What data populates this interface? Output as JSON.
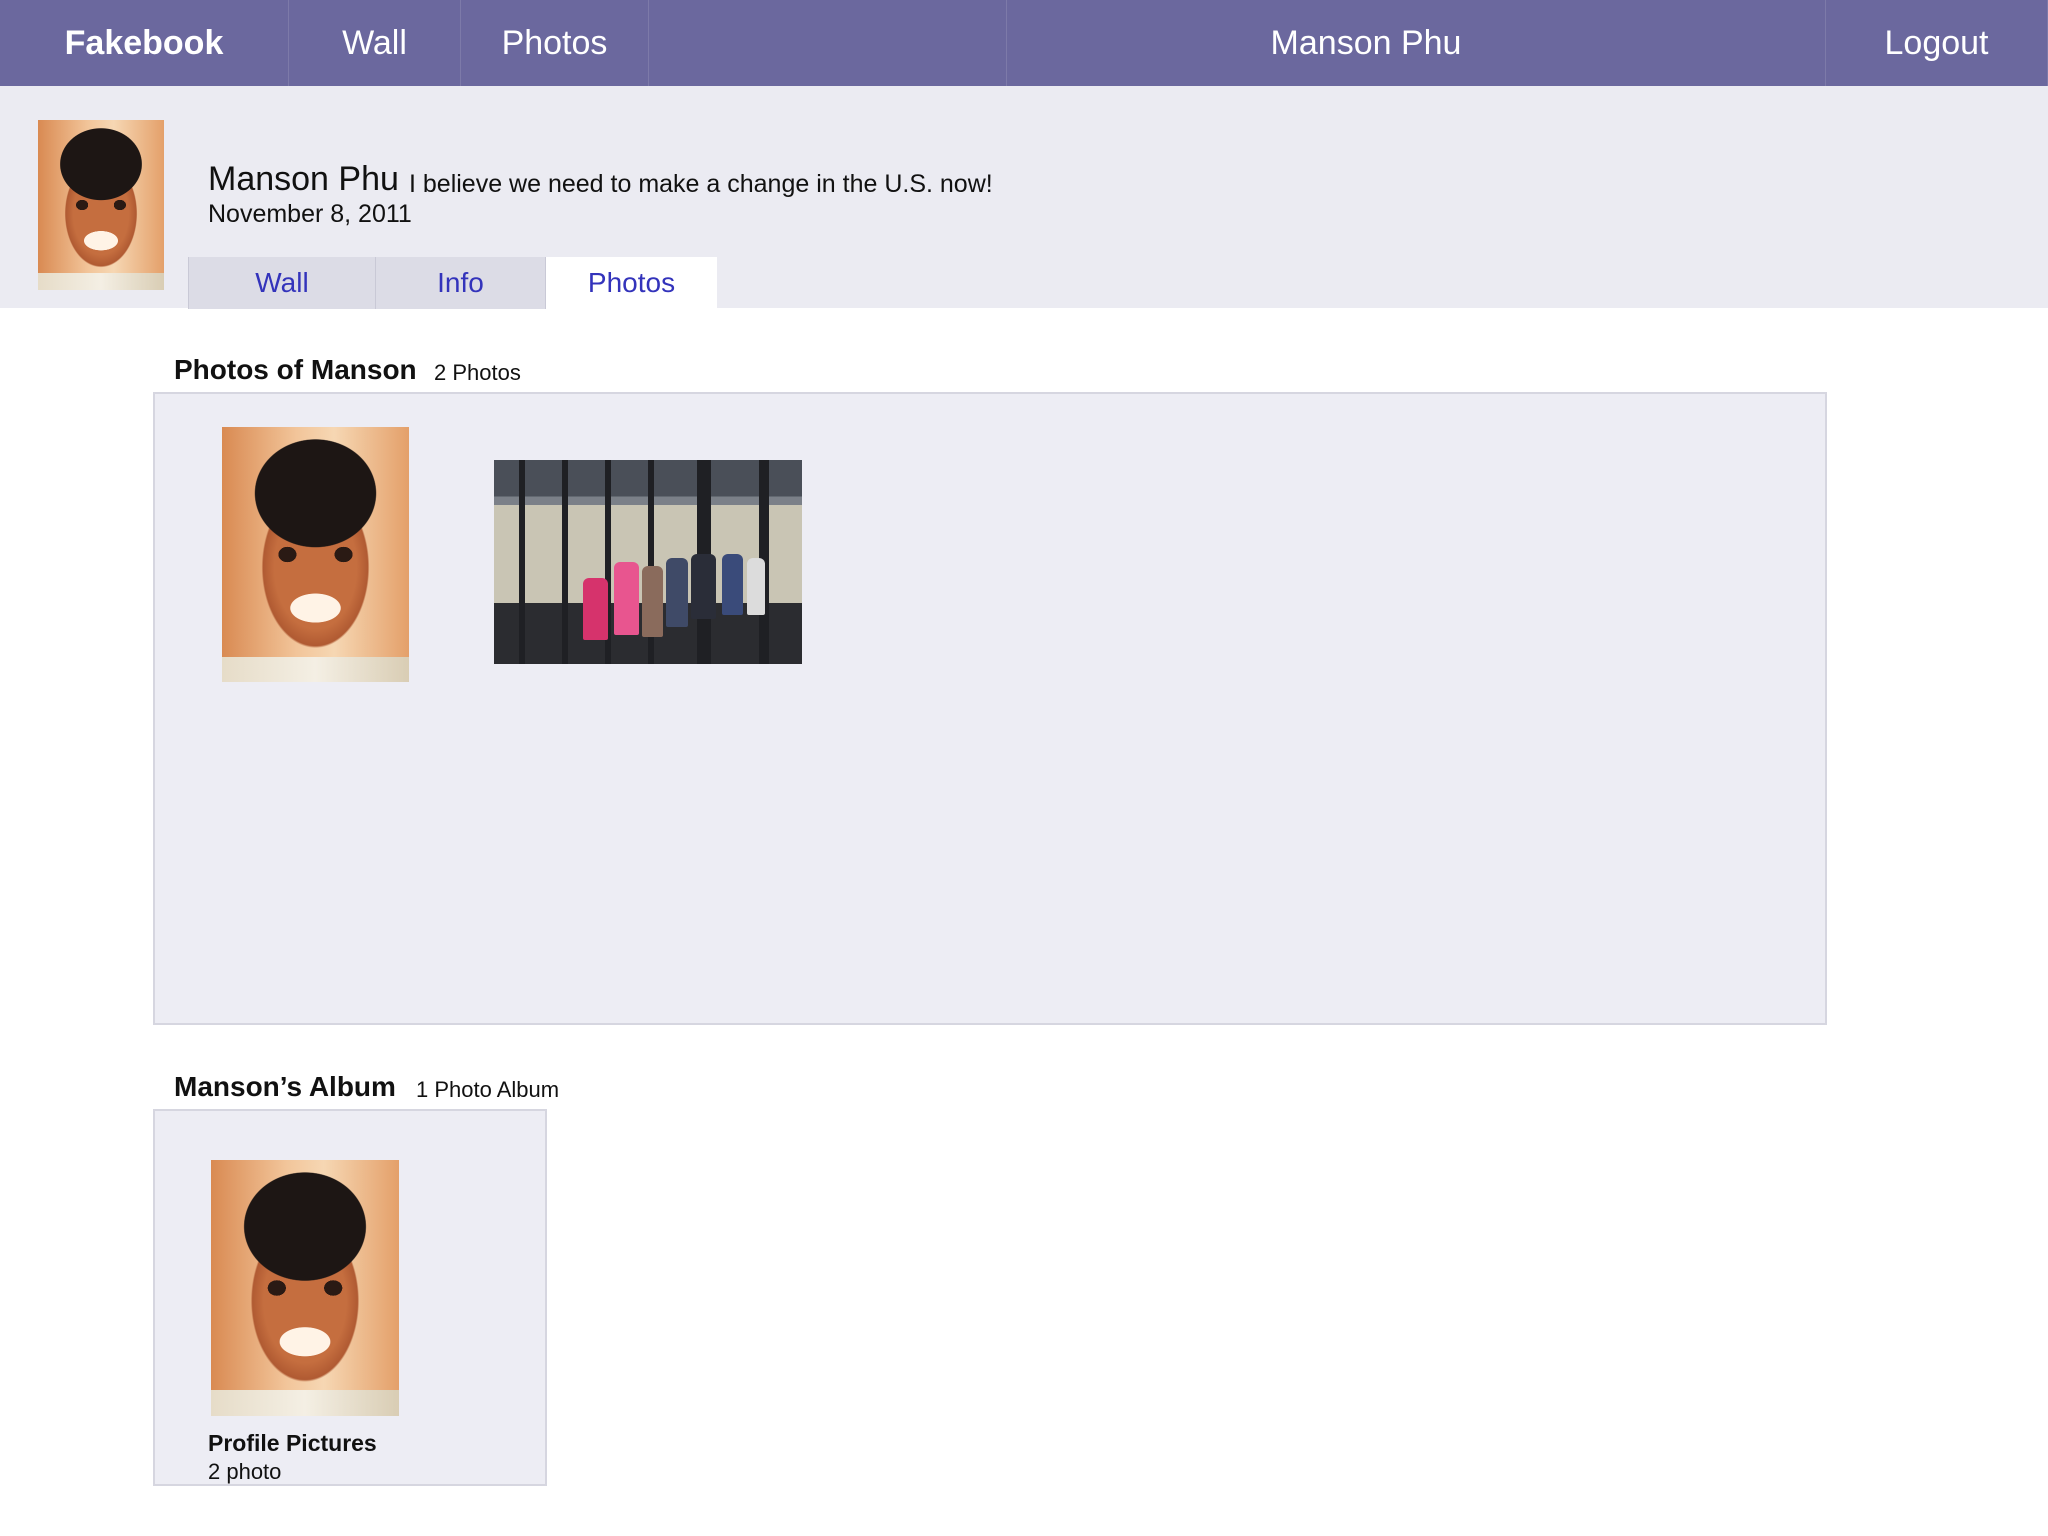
{
  "nav": {
    "brand": "Fakebook",
    "wall": "Wall",
    "photos": "Photos",
    "user": "Manson Phu",
    "logout": "Logout"
  },
  "profile": {
    "name": "Manson Phu",
    "status": "I believe we need to make a change in the U.S. now!",
    "date": "November 8, 2011"
  },
  "tabs": [
    {
      "label": "Wall",
      "active": false
    },
    {
      "label": "Info",
      "active": false
    },
    {
      "label": "Photos",
      "active": true
    }
  ],
  "photos_section": {
    "title": "Photos of Manson",
    "count": "2 Photos"
  },
  "album_section": {
    "title": "Manson’s Album",
    "count": "1 Photo Album",
    "album": {
      "name": "Profile Pictures",
      "count": "2 photo"
    }
  },
  "colors": {
    "nav_bg": "#6b689e",
    "header_bg": "#ebebf2",
    "panel_bg": "#ededf4",
    "tab_link": "#3333bb"
  }
}
